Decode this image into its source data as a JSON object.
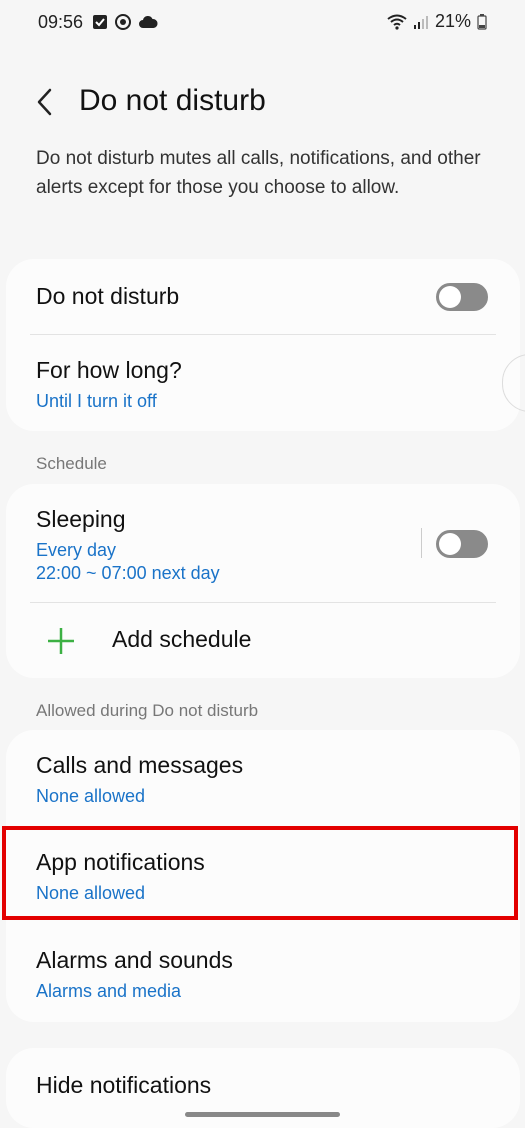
{
  "status": {
    "time": "09:56",
    "battery": "21%",
    "icons_left": [
      "checkbox-icon",
      "sync-icon",
      "cloud-icon"
    ],
    "icons_right": [
      "wifi-icon",
      "signal-icon",
      "battery-icon"
    ]
  },
  "header": {
    "title": "Do not disturb"
  },
  "description": "Do not disturb mutes all calls, notifications, and other alerts except for those you choose to allow.",
  "main": {
    "dnd_label": "Do not disturb",
    "dnd_enabled": false,
    "how_long_title": "For how long?",
    "how_long_value": "Until I turn it off"
  },
  "schedule": {
    "section_label": "Schedule",
    "item_title": "Sleeping",
    "item_days": "Every day",
    "item_time": "22:00 ~ 07:00 next day",
    "item_enabled": false,
    "add_label": "Add schedule"
  },
  "allowed": {
    "section_label": "Allowed during Do not disturb",
    "items": [
      {
        "title": "Calls and messages",
        "value": "None allowed"
      },
      {
        "title": "App notifications",
        "value": "None allowed"
      },
      {
        "title": "Alarms and sounds",
        "value": "Alarms and media"
      }
    ]
  },
  "hide": {
    "title": "Hide notifications"
  },
  "colors": {
    "accent": "#1a73c8",
    "highlight": "#e30000",
    "plus": "#3cb043"
  }
}
